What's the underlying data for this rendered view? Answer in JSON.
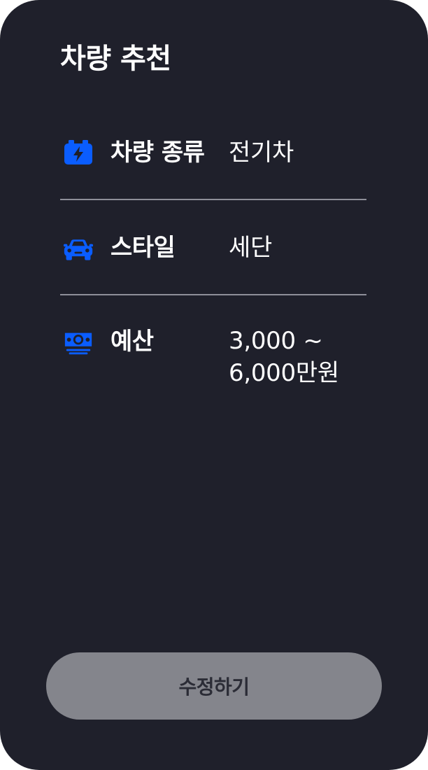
{
  "header": {
    "title": "차량 추천"
  },
  "summary": {
    "rows": [
      {
        "icon": "battery-bolt-icon",
        "label": "차량 종류",
        "value_lines": [
          "전기차"
        ]
      },
      {
        "icon": "car-icon",
        "label": "스타일",
        "value_lines": [
          "세단"
        ]
      },
      {
        "icon": "money-icon",
        "label": "예산",
        "value_lines": [
          "3,000 ~",
          "6,000만원"
        ]
      }
    ]
  },
  "footer": {
    "edit_label": "수정하기"
  },
  "colors": {
    "background": "#1f202b",
    "accent": "#0a5dff",
    "divider": "#8e8f99",
    "button_bg": "#84858c",
    "button_text": "#2b2c36"
  }
}
